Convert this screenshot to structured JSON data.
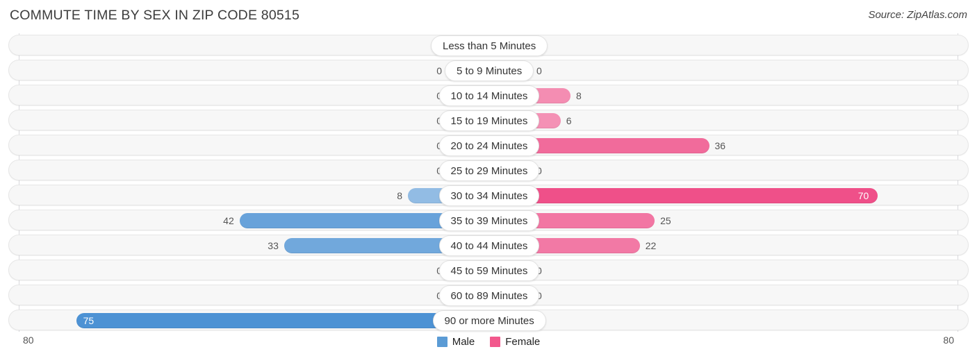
{
  "header": {
    "title": "COMMUTE TIME BY SEX IN ZIP CODE 80515",
    "source": "Source: ZipAtlas.com"
  },
  "footer": {
    "axis_left": "80",
    "axis_right": "80"
  },
  "legend": [
    {
      "label": "Male",
      "color": "#5B9BD5"
    },
    {
      "label": "Female",
      "color": "#F2588C"
    }
  ],
  "chart_data": {
    "type": "bar",
    "orientation": "horizontal",
    "style": "diverging-bidirectional",
    "title": "COMMUTE TIME BY SEX IN ZIP CODE 80515",
    "xlabel": "",
    "ylabel": "",
    "xlim": [
      -80,
      80
    ],
    "axis_max": 80,
    "grid": false,
    "legend_position": "bottom-center",
    "categories": [
      "Less than 5 Minutes",
      "5 to 9 Minutes",
      "10 to 14 Minutes",
      "15 to 19 Minutes",
      "20 to 24 Minutes",
      "25 to 29 Minutes",
      "30 to 34 Minutes",
      "35 to 39 Minutes",
      "40 to 44 Minutes",
      "45 to 59 Minutes",
      "60 to 89 Minutes",
      "90 or more Minutes"
    ],
    "series": [
      {
        "name": "Male",
        "color": "#5B9BD5",
        "direction": "left",
        "values": [
          0,
          0,
          0,
          0,
          0,
          0,
          8,
          42,
          33,
          0,
          0,
          75
        ]
      },
      {
        "name": "Female",
        "color": "#F2588C",
        "direction": "right",
        "values": [
          0,
          0,
          8,
          6,
          36,
          0,
          70,
          25,
          22,
          0,
          0,
          0
        ]
      }
    ]
  }
}
